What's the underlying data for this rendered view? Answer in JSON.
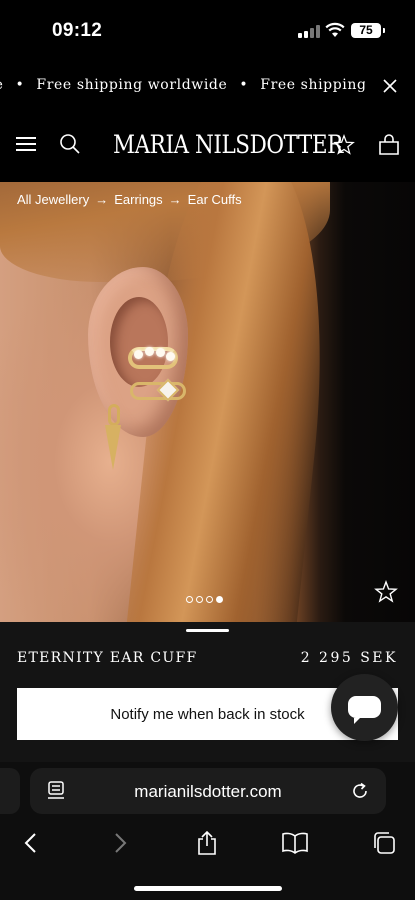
{
  "status_bar": {
    "time": "09:12",
    "battery": "75"
  },
  "banner": {
    "segments": [
      "ide",
      "Free shipping worldwide",
      "Free shipping wor"
    ]
  },
  "header": {
    "logo": "MARIA NILSDOTTER"
  },
  "breadcrumb": {
    "items": [
      "All Jewellery",
      "Earrings",
      "Ear Cuffs"
    ]
  },
  "gallery": {
    "dot_count": 4,
    "active_dot": 4
  },
  "product": {
    "name": "ETERNITY EAR CUFF",
    "price": "2 295 SEK",
    "notify_label": "Notify me when back in stock"
  },
  "browser": {
    "url": "marianilsdotter.com"
  },
  "colors": {
    "background": "#000000",
    "panel": "#141414",
    "button": "#ffffff",
    "gold": "#e3c27a"
  }
}
